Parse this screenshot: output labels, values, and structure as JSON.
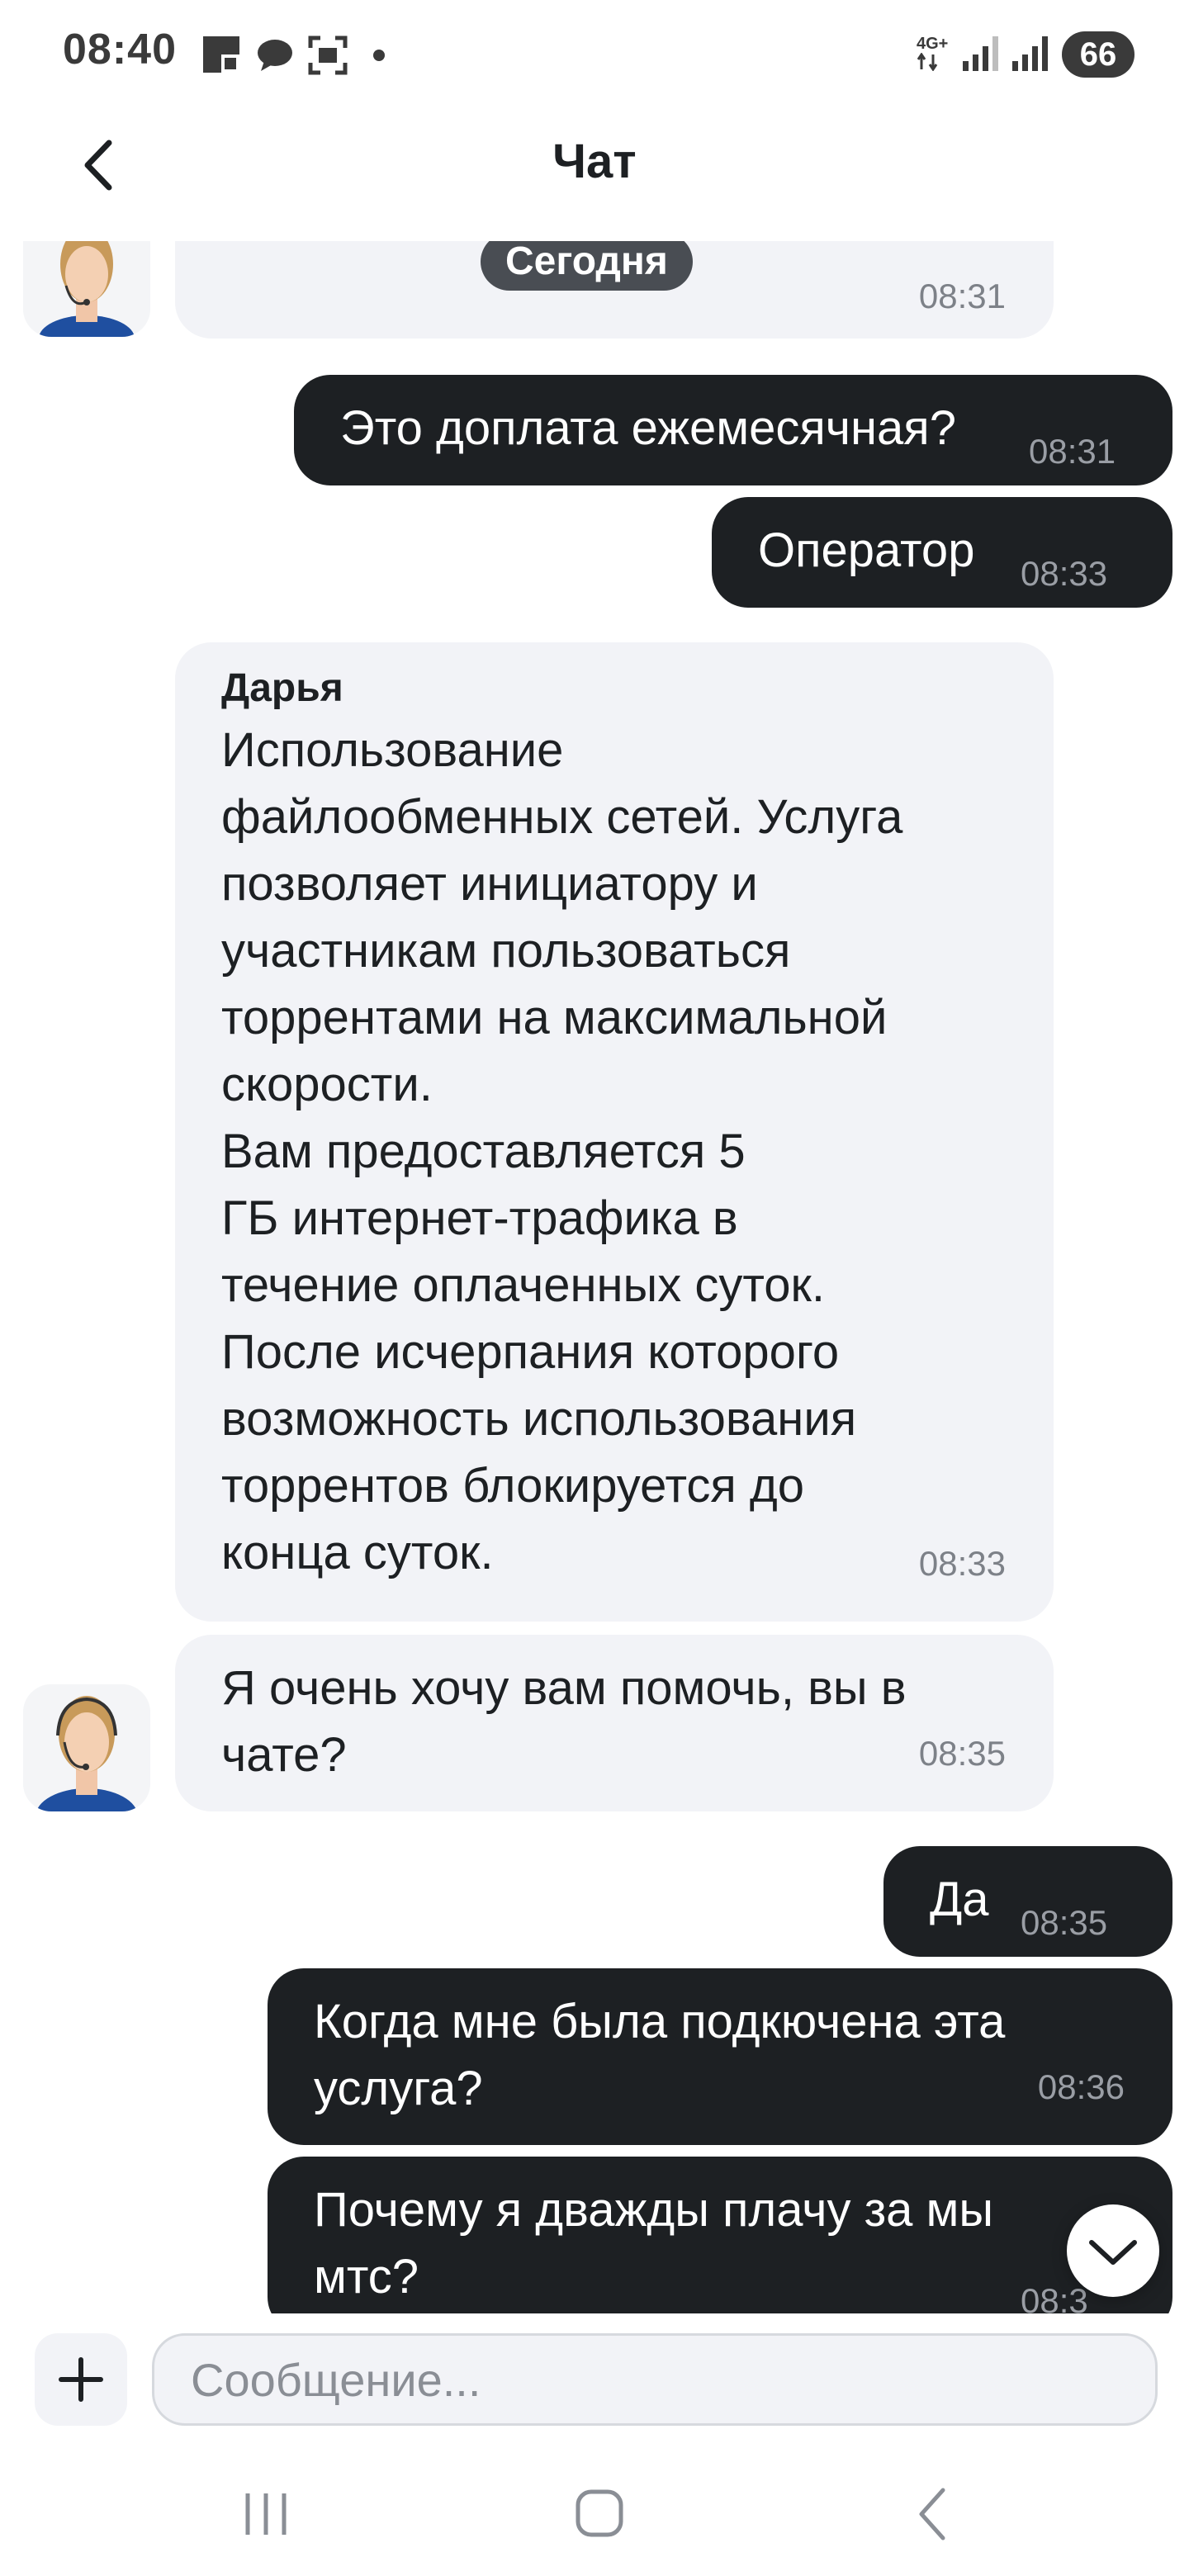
{
  "status_bar": {
    "time": "08:40",
    "operator_icon": "mts-logo-icon",
    "network_label": "4G+",
    "battery": "66"
  },
  "header": {
    "title": "Чат",
    "back_icon": "chevron-left-icon"
  },
  "chat": {
    "date_label": "Сегодня",
    "messages": [
      {
        "from": "operator",
        "time": "08:31"
      },
      {
        "from": "user",
        "text": "Это доплата ежемесячная?",
        "time": "08:31"
      },
      {
        "from": "user",
        "text": "Оператор",
        "time": "08:33"
      },
      {
        "from": "operator",
        "author": "Дарья",
        "lines": [
          "Использование",
          "файлообменных сетей. Услуга",
          "позволяет инициатору и",
          "участникам пользоваться",
          "торрентами на максимальной",
          "скорости.",
          "Вам предоставляется 5",
          "ГБ интернет-трафика в",
          "течение оплаченных суток.",
          "После исчерпания которого",
          "возможность использования",
          "торрентов блокируется до",
          "конца суток."
        ],
        "time": "08:33"
      },
      {
        "from": "operator",
        "lines": [
          "Я очень хочу вам помочь, вы в",
          "чате?"
        ],
        "time": "08:35"
      },
      {
        "from": "user",
        "text": "Да",
        "time": "08:35"
      },
      {
        "from": "user",
        "lines": [
          "Когда мне была подкючена эта",
          "услуга?"
        ],
        "time": "08:36"
      },
      {
        "from": "user",
        "lines": [
          "Почему я дважды плачу за мы",
          "мтс?"
        ],
        "time": "08:3"
      }
    ]
  },
  "composer": {
    "placeholder": "Сообщение..."
  },
  "colors": {
    "user_bubble": "#1d2023",
    "operator_bubble": "#f2f3f7",
    "date_chip": "#494d53"
  }
}
